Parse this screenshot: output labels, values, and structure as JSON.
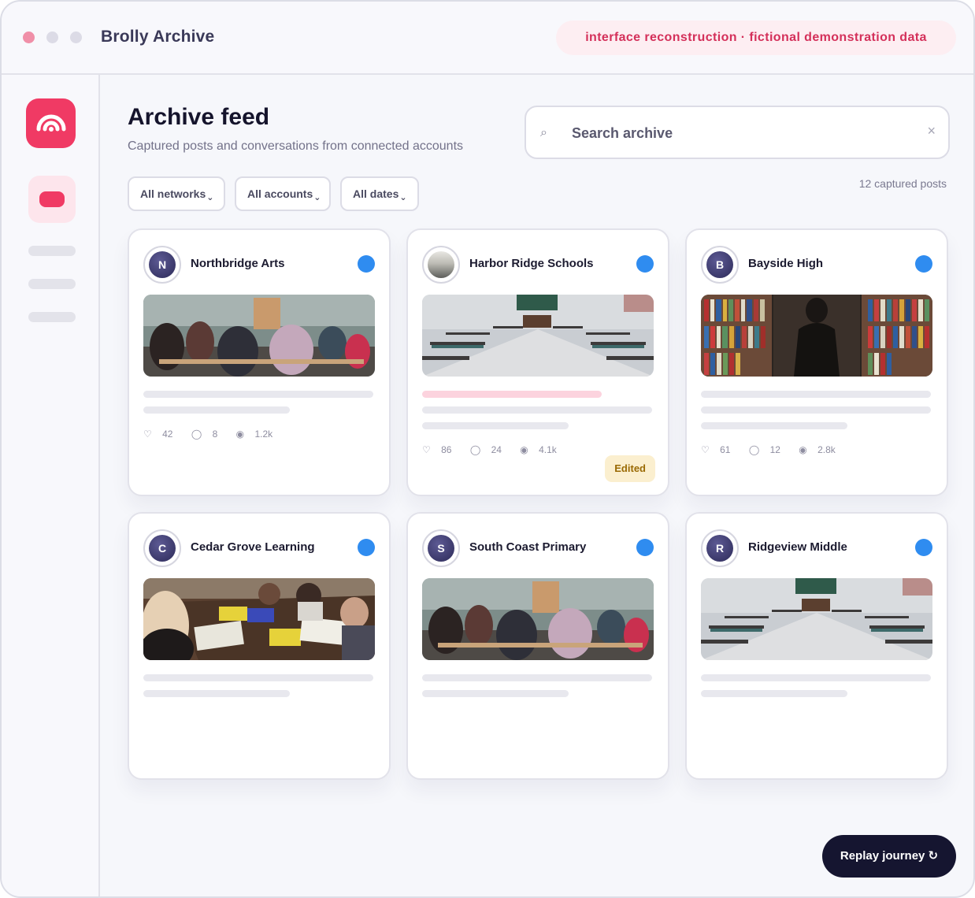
{
  "window": {
    "title": "Brolly Archive",
    "banner": "interface reconstruction · fictional demonstration data"
  },
  "sidebar": {
    "logo_icon": "umbrella-arc-icon",
    "active_item_icon": "archive-pill-icon",
    "accent": "#f03a64"
  },
  "header": {
    "title": "Archive feed",
    "subtitle": "Captured posts and conversations from connected accounts"
  },
  "search": {
    "placeholder": "Search archive",
    "search_icon": "⌕",
    "clear_icon": "×"
  },
  "filters": [
    {
      "label": "All networks",
      "chevron": "⌄"
    },
    {
      "label": "All accounts",
      "chevron": "⌄"
    },
    {
      "label": "All dates",
      "chevron": "⌄"
    }
  ],
  "count_text": "12 captured posts",
  "cards": [
    {
      "initial": "N",
      "name": "Northbridge Arts",
      "image": "classroom-students",
      "highlight": false,
      "stats": {
        "likes": "42",
        "comments": "8",
        "views": "1.2k"
      }
    },
    {
      "initial": "",
      "name": "Harbor Ridge Schools",
      "image": "empty-classroom",
      "highlight": true,
      "stats": {
        "likes": "86",
        "comments": "24",
        "views": "4.1k"
      },
      "badge": "Edited"
    },
    {
      "initial": "B",
      "name": "Bayside High",
      "image": "library-shelves",
      "highlight": false,
      "stats": {
        "likes": "61",
        "comments": "12",
        "views": "2.8k"
      }
    },
    {
      "initial": "C",
      "name": "Cedar Grove Learning",
      "image": "craft-table",
      "highlight": false
    },
    {
      "initial": "S",
      "name": "South Coast Primary",
      "image": "classroom-students",
      "highlight": false
    },
    {
      "initial": "R",
      "name": "Ridgeview Middle",
      "image": "empty-classroom",
      "highlight": false
    }
  ],
  "stat_icons": {
    "likes": "♡",
    "comments": "◯",
    "views": "◉"
  },
  "network_color": "#2f8cf0",
  "replay_button": "Replay journey ↻"
}
